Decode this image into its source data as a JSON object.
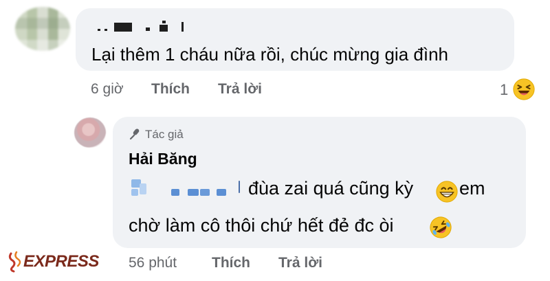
{
  "comment": {
    "text": "Lại thêm 1 cháu nữa rồi, chúc mừng gia đình",
    "time": "6 giờ",
    "like_label": "Thích",
    "reply_label": "Trả lời",
    "reaction_count": "1",
    "reaction_icon": "laughing-emoji-icon"
  },
  "reply": {
    "author_badge": "Tác giả",
    "author_name": "Hải Băng",
    "line1_a": "đùa zai quá cũng kỳ",
    "line1_b": "em",
    "line2": "chờ làm cô thôi chứ hết đẻ đc òi",
    "time": "56 phút",
    "like_label": "Thích",
    "reply_label": "Trả lời"
  },
  "watermark": {
    "text": "EXPRESS"
  },
  "colors": {
    "bubble": "#f0f2f5",
    "meta_text": "#65676b",
    "emoji_yellow": "#f7c325",
    "watermark": "#7b2a1c"
  }
}
